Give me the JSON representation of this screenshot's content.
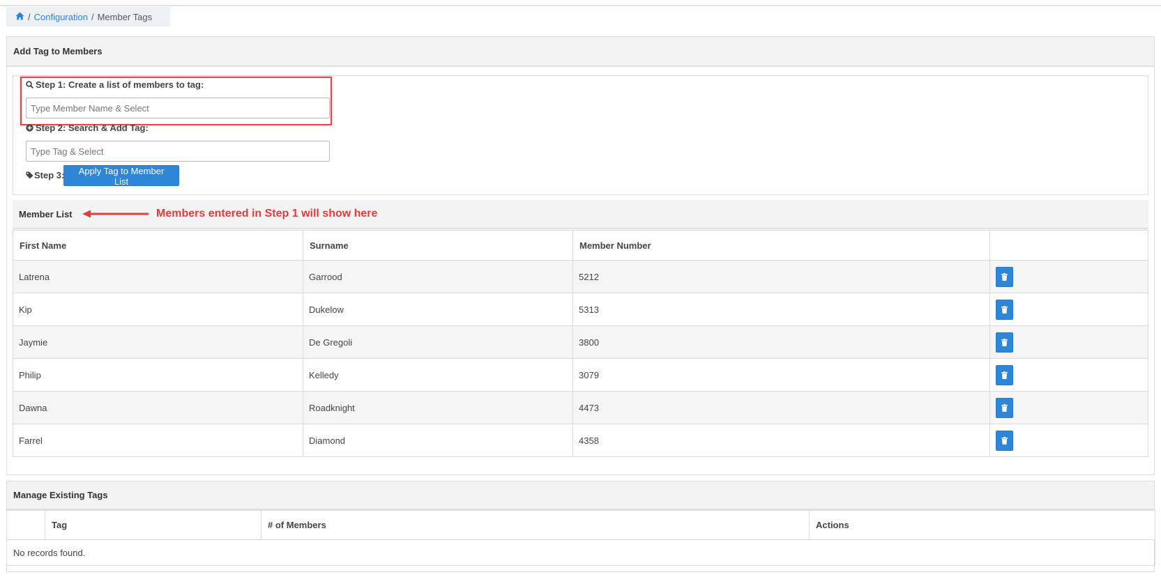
{
  "breadcrumb": {
    "home_icon": "home-icon",
    "configuration": "Configuration",
    "separator": "/",
    "current": "Member Tags"
  },
  "add_panel": {
    "title": "Add Tag to Members",
    "step1": {
      "label": "Step 1: Create a list of members to tag:",
      "icon": "search-icon",
      "placeholder": "Type Member Name & Select",
      "value": ""
    },
    "step2": {
      "label": "Step 2: Search & Add Tag:",
      "icon": "plus-circle-icon",
      "placeholder": "Type Tag & Select",
      "value": ""
    },
    "step3": {
      "label": "Step 3:",
      "icon": "tag-icon",
      "button": "Apply Tag to Member List"
    }
  },
  "member_list": {
    "title": "Member List",
    "annotation": "Members entered in Step 1 will show here",
    "columns": [
      "First Name",
      "Surname",
      "Member Number",
      ""
    ],
    "rows": [
      {
        "first": "Latrena",
        "surname": "Garrood",
        "number": "5212"
      },
      {
        "first": "Kip",
        "surname": "Dukelow",
        "number": "5313"
      },
      {
        "first": "Jaymie",
        "surname": "De Gregoli",
        "number": "3800"
      },
      {
        "first": "Philip",
        "surname": "Kelledy",
        "number": "3079"
      },
      {
        "first": "Dawna",
        "surname": "Roadknight",
        "number": "4473"
      },
      {
        "first": "Farrel",
        "surname": "Diamond",
        "number": "4358"
      }
    ]
  },
  "manage_panel": {
    "title": "Manage Existing Tags",
    "columns": [
      "",
      "Tag",
      "# of Members",
      "Actions"
    ],
    "empty_text": "No records found."
  },
  "colors": {
    "primary": "#2f86d6",
    "link": "#2f82d4",
    "annotation": "#e23c3c"
  }
}
